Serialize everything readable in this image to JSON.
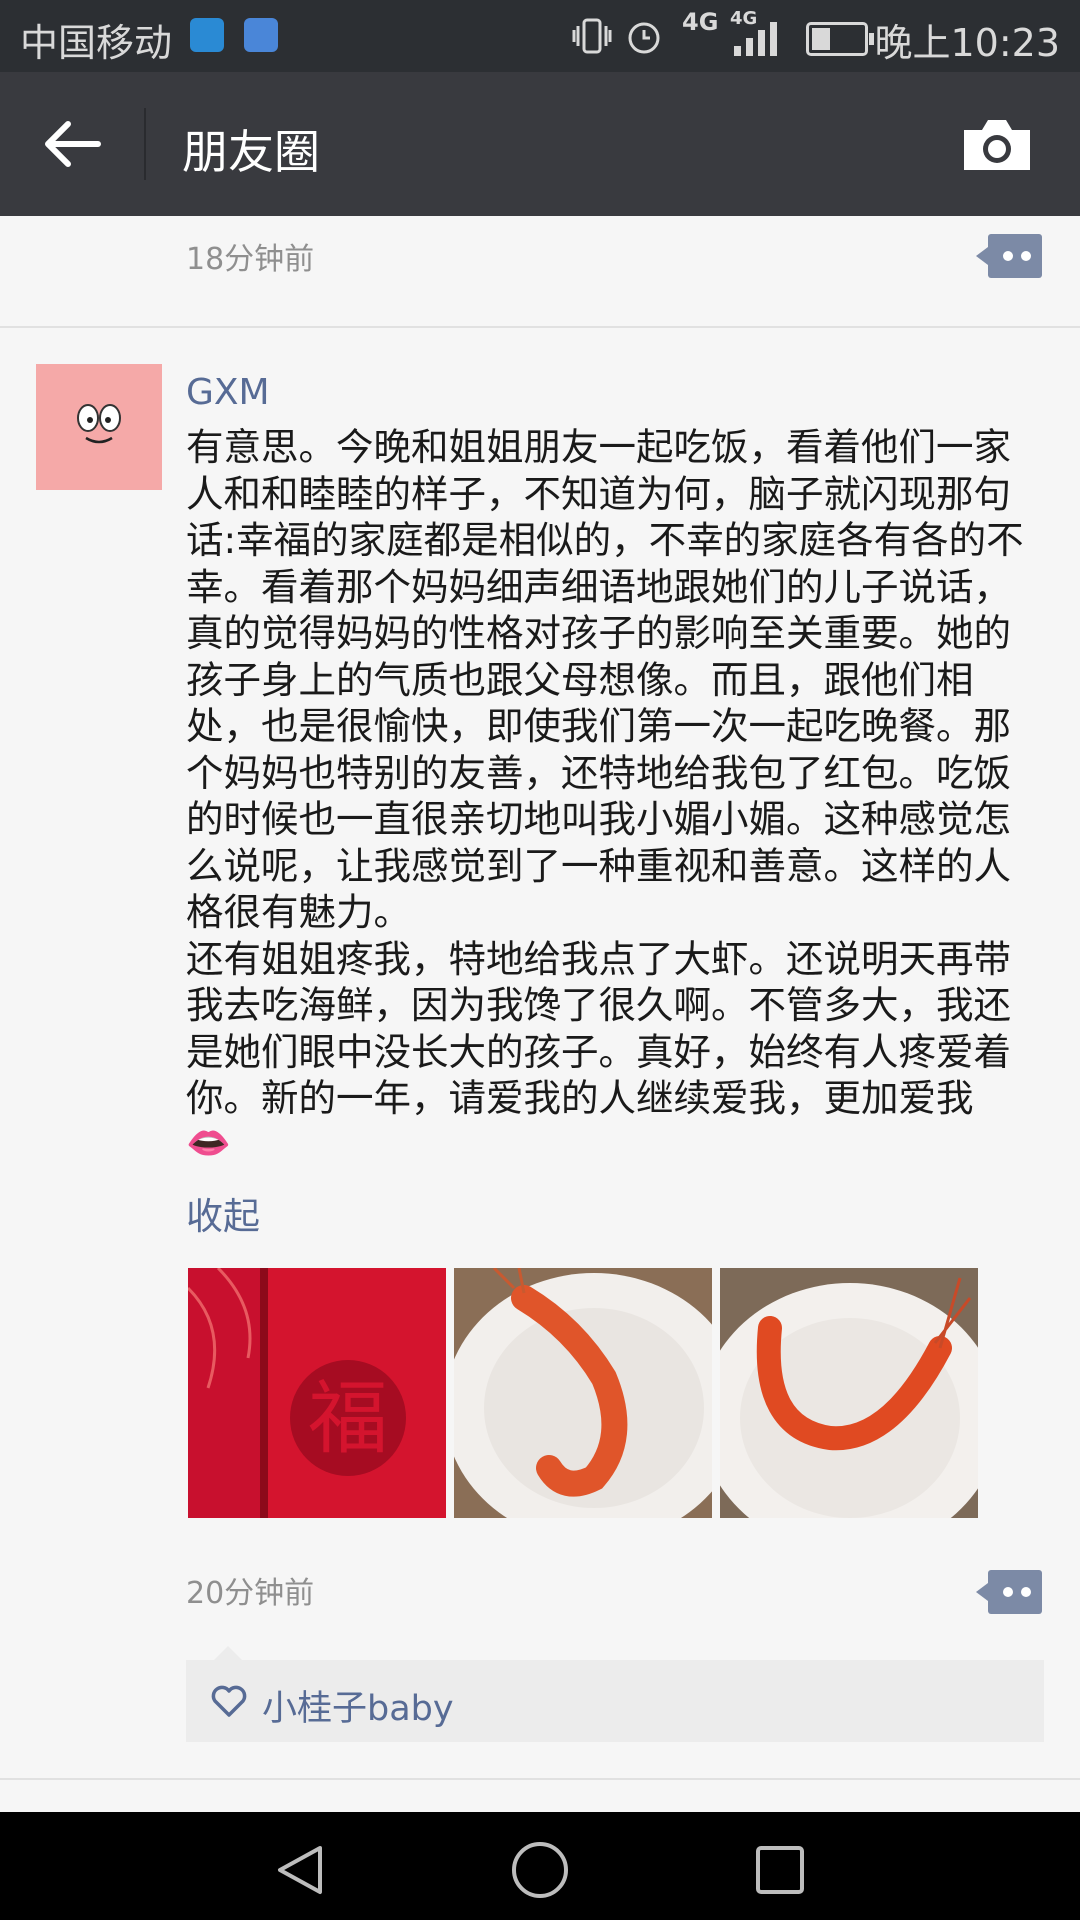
{
  "status_bar": {
    "carrier": "中国移动",
    "network_1": "4G",
    "network_2": "4G",
    "time": "晚上10:23"
  },
  "header": {
    "title": "朋友圈",
    "back_icon": "arrow-left-icon",
    "camera_icon": "camera-icon"
  },
  "feed": {
    "previous_post_time": "18分钟前",
    "post": {
      "user": "GXM",
      "text": "有意思。今晚和姐姐朋友一起吃饭，看着他们一家人和和睦睦的样子，不知道为何，脑子就闪现那句话:幸福的家庭都是相似的，不幸的家庭各有各的不幸。看着那个妈妈细声细语地跟她们的儿子说话，真的觉得妈妈的性格对孩子的影响至关重要。她的孩子身上的气质也跟父母想像。而且，跟他们相处，也是很愉快，即使我们第一次一起吃晚餐。那个妈妈也特别的友善，还特地给我包了红包。吃饭的时候也一直很亲切地叫我小媚小媚。这种感觉怎么说呢，让我感觉到了一种重视和善意。这样的人格很有魅力。\n还有姐姐疼我，特地给我点了大虾。还说明天再带我去吃海鲜，因为我馋了很久啊。不管多大，我还是她们眼中没长大的孩子。真好，始终有人疼爱着你。新的一年，请爱我的人继续爱我，更加爱我",
      "emoji": "👄",
      "collapse_label": "收起",
      "photos": [
        "red-envelope-photo",
        "shrimp-photo-1",
        "shrimp-photo-2"
      ],
      "time": "20分钟前",
      "likes": "小桂子baby"
    }
  },
  "colors": {
    "header_bg": "#393a3f",
    "link_blue": "#576b95",
    "comment_button": "#7c8aa6"
  }
}
